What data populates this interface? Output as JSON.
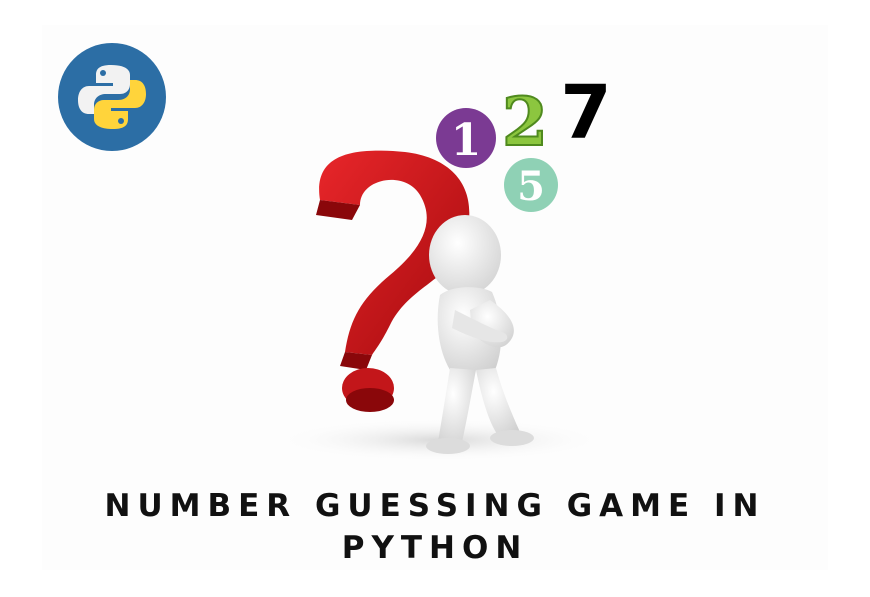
{
  "title": {
    "line1": "NUMBER GUESSING GAME IN",
    "line2": "PYTHON"
  },
  "digits": {
    "one": "1",
    "two": "2",
    "five": "5",
    "seven": "7"
  },
  "logo": {
    "icon": "python-logo-icon"
  },
  "colors": {
    "logo_circle": "#2c6ea5",
    "python_blue": "#f2f2f2",
    "python_yellow": "#ffd43b",
    "question_mark": "#d71418",
    "digit_one_bg": "#7b3a93",
    "digit_two": "#8cc63f",
    "digit_five_bg": "#8fd1b5",
    "digit_seven": "#000000"
  }
}
